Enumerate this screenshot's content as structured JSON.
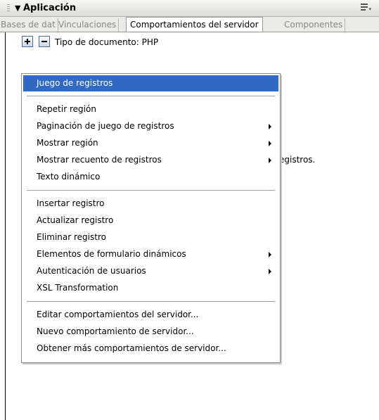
{
  "panel": {
    "title": "Aplicación",
    "collapse_glyph": "▼",
    "options_icon": "panel-options-icon"
  },
  "tabs": [
    {
      "label": "Bases de dat",
      "active": false
    },
    {
      "label": "Vinculaciones",
      "active": false
    },
    {
      "label": "Comportamientos del servidor",
      "active": true
    },
    {
      "label": "Componentes",
      "active": false
    }
  ],
  "toolbar": {
    "add_icon": "plus-icon",
    "remove_icon": "minus-icon",
    "document_type": "Tipo de documento: PHP"
  },
  "background_text": "egistros.",
  "menu": {
    "items": [
      {
        "label": "Juego de registros",
        "highlighted": true,
        "submenu": false
      },
      {
        "label": "Repetir región",
        "submenu": false
      },
      {
        "label": "Paginación de juego de registros",
        "submenu": true
      },
      {
        "label": "Mostrar región",
        "submenu": true
      },
      {
        "label": "Mostrar recuento de registros",
        "submenu": true
      },
      {
        "label": "Texto dinámico",
        "submenu": false
      },
      {
        "label": "Insertar registro",
        "submenu": false
      },
      {
        "label": "Actualizar registro",
        "submenu": false
      },
      {
        "label": "Eliminar registro",
        "submenu": false
      },
      {
        "label": "Elementos de formulario dinámicos",
        "submenu": true
      },
      {
        "label": "Autenticación de usuarios",
        "submenu": true
      },
      {
        "label": "XSL Transformation",
        "submenu": false
      },
      {
        "label": "Editar comportamientos del servidor...",
        "submenu": false
      },
      {
        "label": "Nuevo comportamiento de servidor...",
        "submenu": false
      },
      {
        "label": "Obtener más comportamientos de servidor...",
        "submenu": false
      }
    ]
  },
  "colors": {
    "highlight": "#316ac5",
    "header_bg": "#dcdcd6"
  }
}
